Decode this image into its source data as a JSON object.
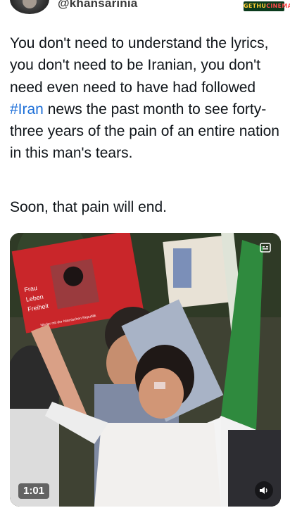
{
  "header": {
    "handle": "@khansarinia",
    "watermark_a": "GETHU",
    "watermark_b": "CINEMA"
  },
  "tweet": {
    "text_before_hashtag": "You don't need to understand the lyrics, you don't need to be Iranian, you don't need even need to have had followed ",
    "hashtag": "#Iran",
    "text_after_hashtag": " news the past month to see forty-three years of the pain of an entire nation in this man's tears.",
    "text_second": "Soon, that pain will end."
  },
  "media": {
    "duration": "1:01",
    "sign_lines": [
      "Frau",
      "Leben",
      "Freiheit"
    ],
    "sign_footer": "Nieder mit der Islamischen Republik",
    "icons": [
      "caption-icon",
      "speaker-icon"
    ]
  }
}
